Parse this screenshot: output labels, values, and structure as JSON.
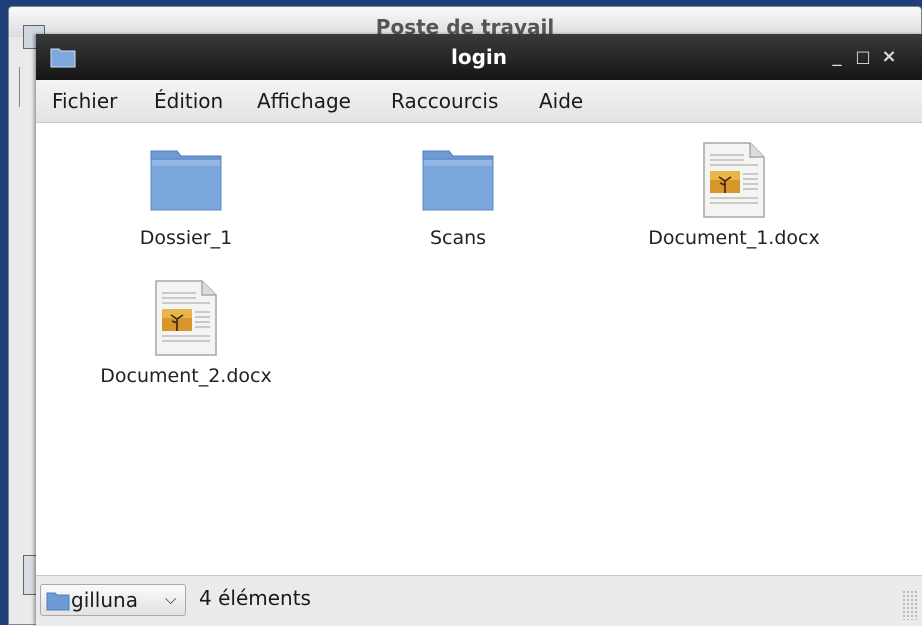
{
  "background_window": {
    "title": "Poste de travail"
  },
  "window": {
    "title": "login"
  },
  "window_buttons": {
    "minimize": "_",
    "maximize": "□",
    "close": "×"
  },
  "menu": [
    "Fichier",
    "Édition",
    "Affichage",
    "Raccourcis",
    "Aide"
  ],
  "files": [
    {
      "name": "Dossier_1",
      "type": "folder"
    },
    {
      "name": "Scans",
      "type": "folder"
    },
    {
      "name": "Document_1.docx",
      "type": "document"
    },
    {
      "name": "Document_2.docx",
      "type": "document"
    }
  ],
  "status": {
    "location": "gilluna",
    "count": "4 éléments"
  },
  "colors": {
    "folder": "#6f9bd4",
    "titlebar": "#1e1e1e",
    "desktop": "#1e3f78"
  }
}
